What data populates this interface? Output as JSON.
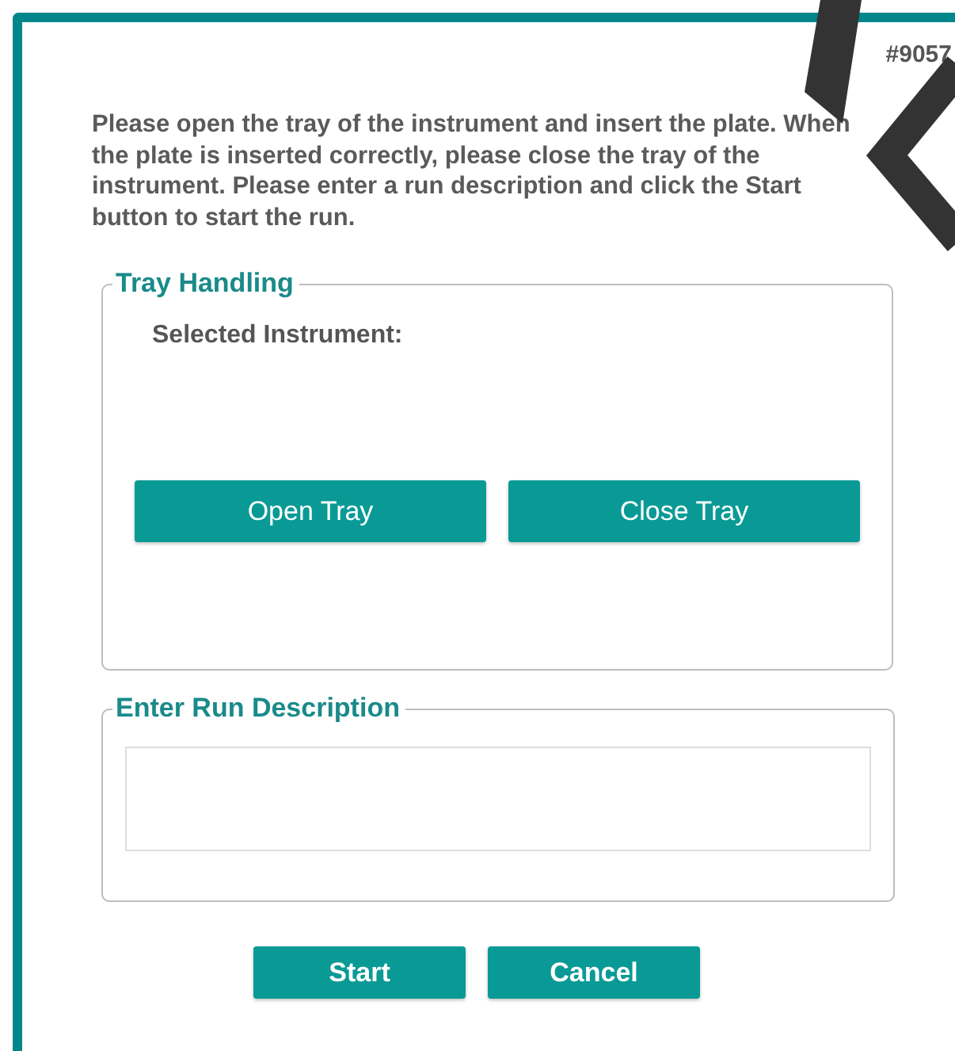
{
  "id_label": "#9057",
  "instructions": "Please open the tray of the instrument and insert the plate. When the plate is inserted correctly, please close the tray of the instrument. Please enter a run description and click the Start button to start the run.",
  "tray_handling": {
    "legend": "Tray Handling",
    "label": "Selected Instrument:",
    "buttons": [
      "Open Tray",
      "Close Tray"
    ]
  },
  "run_description": {
    "legend": "Enter Run Description"
  },
  "buttons": [
    "Start",
    "Cancel"
  ]
}
